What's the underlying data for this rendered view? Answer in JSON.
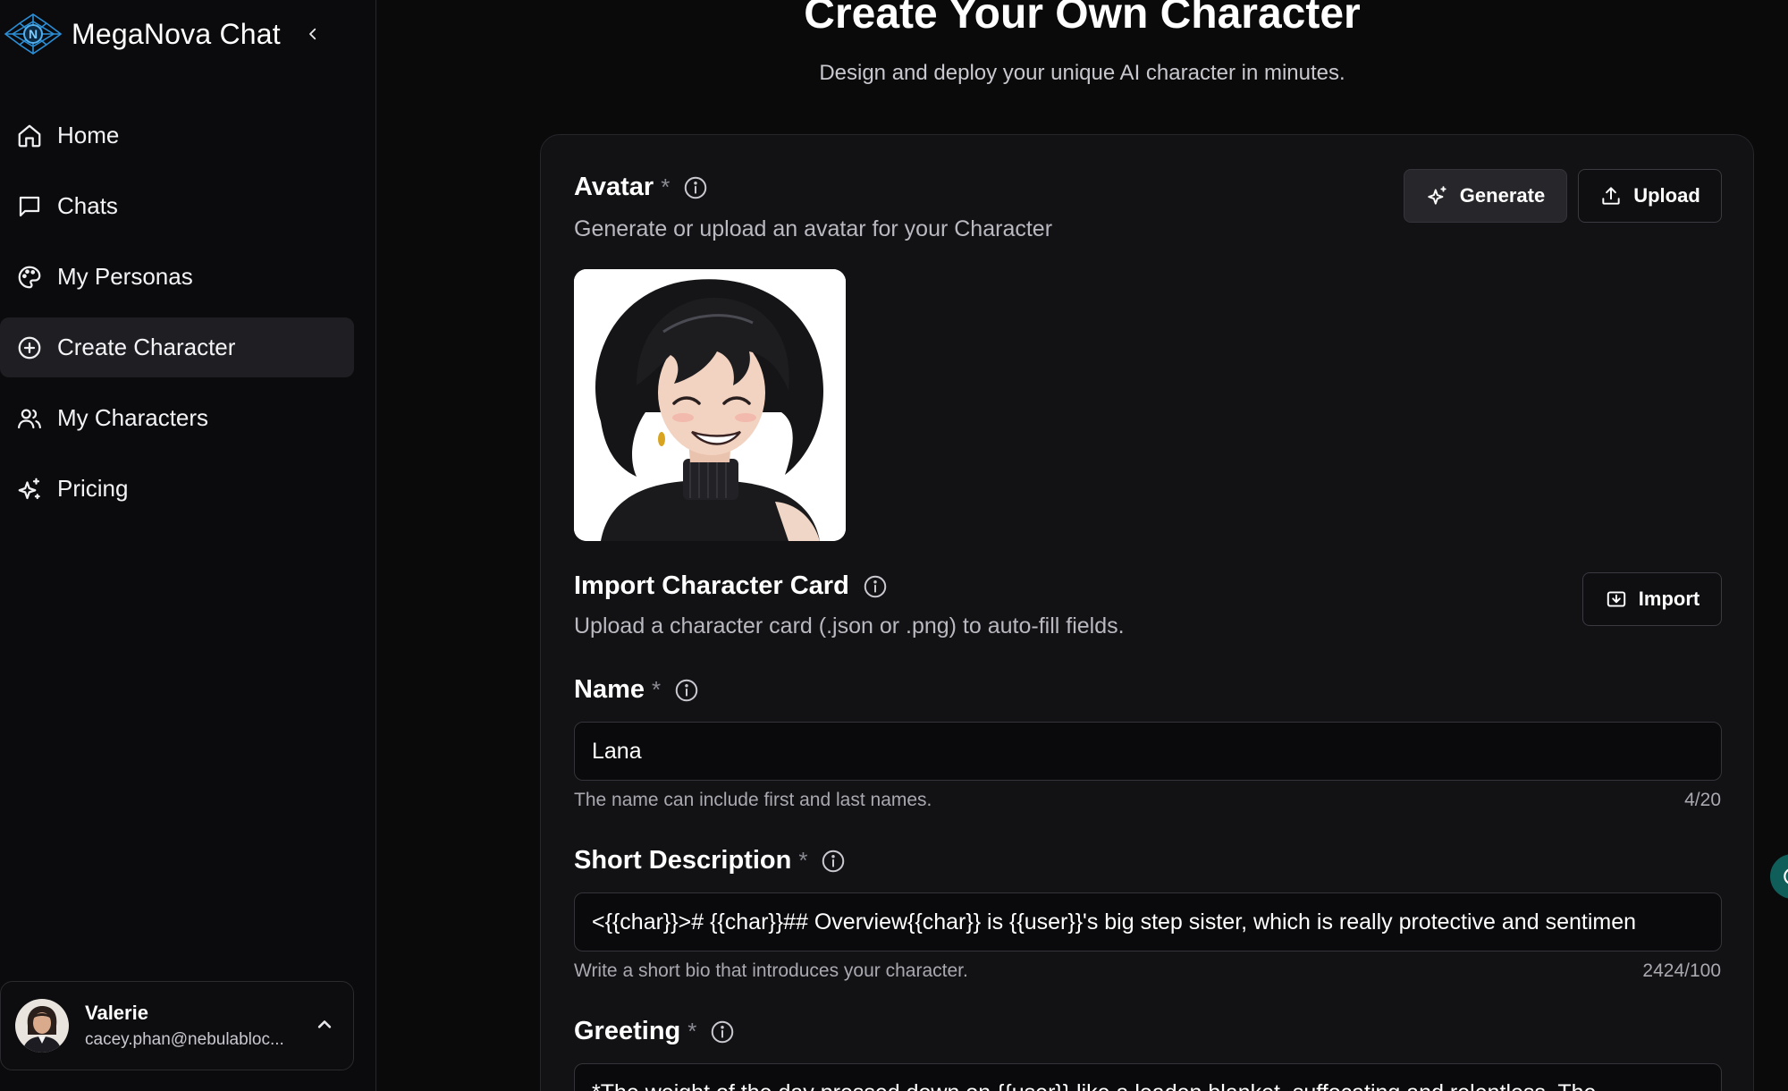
{
  "app": {
    "name": "MegaNova Chat"
  },
  "sidebar": {
    "items": [
      {
        "label": "Home",
        "icon": "home-icon"
      },
      {
        "label": "Chats",
        "icon": "chat-bubble-icon"
      },
      {
        "label": "My Personas",
        "icon": "palette-icon"
      },
      {
        "label": "Create Character",
        "icon": "plus-circle-icon",
        "active": true
      },
      {
        "label": "My Characters",
        "icon": "users-icon"
      },
      {
        "label": "Pricing",
        "icon": "sparkles-icon"
      }
    ],
    "user": {
      "name": "Valerie",
      "email": "cacey.phan@nebulabloc..."
    }
  },
  "page": {
    "title": "Create Your Own Character",
    "subtitle": "Design and deploy your unique AI character in minutes."
  },
  "form": {
    "avatar": {
      "label": "Avatar",
      "required_mark": "*",
      "description": "Generate or upload an avatar for your Character",
      "generate_label": "Generate",
      "upload_label": "Upload"
    },
    "import_card": {
      "label": "Import Character Card",
      "description": "Upload a character card (.json or .png) to auto-fill fields.",
      "import_label": "Import"
    },
    "name": {
      "label": "Name",
      "required_mark": "*",
      "value": "Lana",
      "helper": "The name can include first and last names.",
      "counter": "4/20"
    },
    "short_description": {
      "label": "Short Description",
      "required_mark": "*",
      "value": "<{{char}}># {{char}}## Overview{{char}} is {{user}}'s big step sister, which is really protective and sentimen",
      "helper": "Write a short bio that introduces your character.",
      "counter": "2424/100"
    },
    "greeting": {
      "label": "Greeting",
      "required_mark": "*",
      "value": "*The weight of the day pressed down on {{user}} like a leaden blanket, suffocating and relentless. The"
    }
  },
  "colors": {
    "background": "#0a0a0b",
    "card": "#121215",
    "active_nav": "#1f1f23",
    "accent_teal": "#0f5e5a",
    "logo_blue": "#2a8fd8"
  }
}
